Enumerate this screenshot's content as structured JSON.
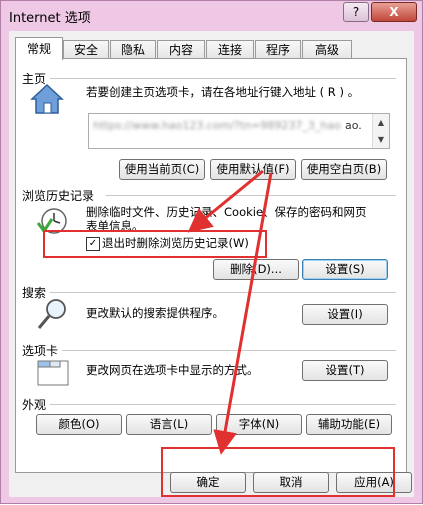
{
  "window": {
    "title": "Internet 选项",
    "help_label": "?",
    "close_label": "X"
  },
  "tabs": [
    "常规",
    "安全",
    "隐私",
    "内容",
    "连接",
    "程序",
    "高级"
  ],
  "homepage": {
    "header": "主页",
    "description": "若要创建主页选项卡，请在各地址行键入地址 ( R ) 。",
    "url_blurred": "https://www.hao123.com/?tn=989237_3_hao",
    "url_suffix": "ao.",
    "buttons": {
      "use_current": "使用当前页(C)",
      "use_default": "使用默认值(F)",
      "use_blank": "使用空白页(B)"
    }
  },
  "history": {
    "header": "浏览历史记录",
    "description_1": "删除临时文件、历史记录、Cookie、保存的密码和网页",
    "description_2": "表单信息。",
    "checkbox_label": "退出时删除浏览历史记录(W)",
    "checkbox_mark": "✓",
    "checked": true,
    "buttons": {
      "delete": "删除(D)...",
      "settings": "设置(S)"
    }
  },
  "search": {
    "header": "搜索",
    "description": "更改默认的搜索提供程序。",
    "settings": "设置(I)"
  },
  "tabs_section": {
    "header": "选项卡",
    "description": "更改网页在选项卡中显示的方式。",
    "settings": "设置(T)"
  },
  "appearance": {
    "header": "外观",
    "buttons": {
      "colors": "颜色(O)",
      "languages": "语言(L)",
      "fonts": "字体(N)",
      "accessibility": "辅助功能(E)"
    }
  },
  "footer": {
    "ok": "确定",
    "cancel": "取消",
    "apply": "应用(A)"
  },
  "annotation_color": "#e03030"
}
